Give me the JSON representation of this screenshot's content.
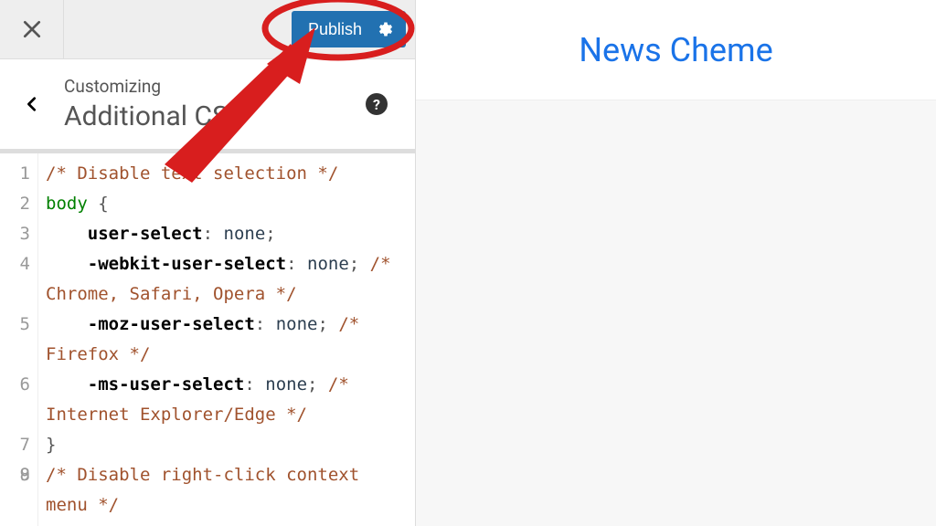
{
  "topbar": {
    "publish_label": "Publish"
  },
  "panel": {
    "eyebrow": "Customizing",
    "title": "Additional CSS",
    "help": "?"
  },
  "editor": {
    "line_numbers": [
      "1",
      "2",
      "3",
      "4",
      "5",
      "6",
      "7",
      "8",
      "9"
    ],
    "code_tokens": [
      [
        {
          "t": "comment",
          "v": "/* Disable text selection */"
        }
      ],
      [
        {
          "t": "tag",
          "v": "body"
        },
        {
          "t": "plain",
          "v": " "
        },
        {
          "t": "punc",
          "v": "{"
        }
      ],
      [
        {
          "t": "plain",
          "v": "    "
        },
        {
          "t": "prop",
          "v": "user-select"
        },
        {
          "t": "punc",
          "v": ": "
        },
        {
          "t": "val",
          "v": "none"
        },
        {
          "t": "punc",
          "v": ";"
        }
      ],
      [
        {
          "t": "plain",
          "v": "    "
        },
        {
          "t": "prop",
          "v": "-webkit-user-select"
        },
        {
          "t": "punc",
          "v": ": "
        },
        {
          "t": "val",
          "v": "none"
        },
        {
          "t": "punc",
          "v": "; "
        },
        {
          "t": "comment",
          "v": "/* Chrome, Safari, Opera */"
        }
      ],
      [
        {
          "t": "plain",
          "v": "    "
        },
        {
          "t": "prop",
          "v": "-moz-user-select"
        },
        {
          "t": "punc",
          "v": ": "
        },
        {
          "t": "val",
          "v": "none"
        },
        {
          "t": "punc",
          "v": "; "
        },
        {
          "t": "comment",
          "v": "/* Firefox */"
        }
      ],
      [
        {
          "t": "plain",
          "v": "    "
        },
        {
          "t": "prop",
          "v": "-ms-user-select"
        },
        {
          "t": "punc",
          "v": ": "
        },
        {
          "t": "val",
          "v": "none"
        },
        {
          "t": "punc",
          "v": "; "
        },
        {
          "t": "comment",
          "v": "/* Internet Explorer/Edge */"
        }
      ],
      [
        {
          "t": "punc",
          "v": "}"
        }
      ],
      [
        {
          "t": "plain",
          "v": ""
        }
      ],
      [
        {
          "t": "comment",
          "v": "/* Disable right-click context menu */"
        }
      ]
    ]
  },
  "preview": {
    "site_title": "News Cheme"
  },
  "colors": {
    "publish_bg": "#2271b1",
    "link": "#1a73e8",
    "annotation": "#d81e1e"
  }
}
